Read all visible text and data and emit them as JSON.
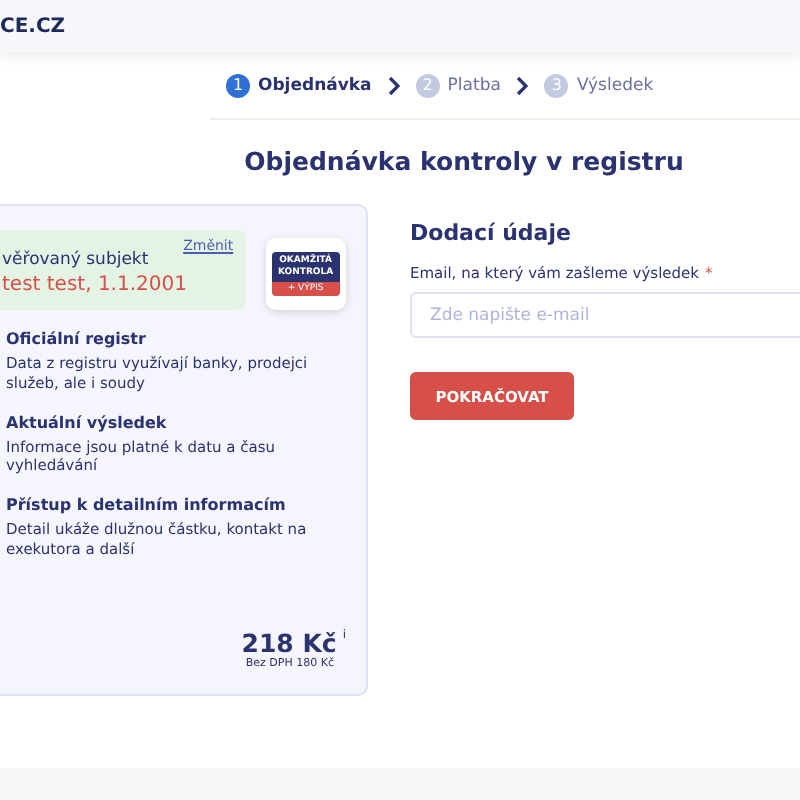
{
  "header": {
    "logo": "CE.CZ"
  },
  "steps": [
    {
      "number": "1",
      "label": "Objednávka",
      "selected": true
    },
    {
      "number": "2",
      "label": "Platba",
      "selected": false
    },
    {
      "number": "3",
      "label": "Výsledek",
      "selected": false
    }
  ],
  "title": "Objednávka kontroly v registru",
  "subject": {
    "label": "věřovaný subjekt",
    "value": "test test, 1.1.2001",
    "change_link": "Změnit"
  },
  "badge": {
    "top": "OKAMŽITÁ KONTROLA",
    "bottom": "+ VÝPIS"
  },
  "features": [
    {
      "title": "Oficiální registr",
      "text": "Data z registru využívají banky, prodejci služeb, ale i soudy"
    },
    {
      "title": "Aktuální výsledek",
      "text": "Informace jsou platné k datu a času vyhledávání"
    },
    {
      "title": "Přístup k detailním informacím",
      "text": "Detail ukáže dlužnou částku, kontakt na exekutora a další"
    }
  ],
  "price": {
    "amount": "218 Kč",
    "info": "i",
    "net": "Bez DPH 180 Kč"
  },
  "form": {
    "heading": "Dodací údaje",
    "email_label": "Email, na který vám zašleme výsledek",
    "required_mark": "*",
    "placeholder": "Zde napište e-mail",
    "submit": "POKRAČOVAT"
  }
}
